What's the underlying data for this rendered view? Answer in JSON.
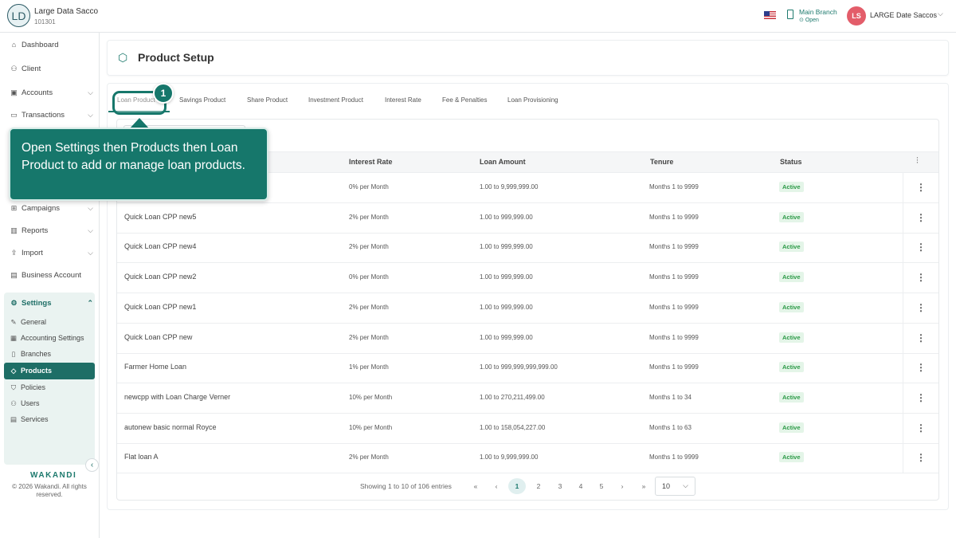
{
  "topbar": {
    "org_initials": "LD",
    "org_name": "Large Data Sacco",
    "org_code": "101301",
    "branch_label": "Main Branch",
    "branch_status": "Open",
    "user_initials": "LS",
    "user_name": "LARGE Date Saccos"
  },
  "sidebar": {
    "items": [
      {
        "label": "Dashboard",
        "icon": "home-icon"
      },
      {
        "label": "Client",
        "icon": "users-icon"
      },
      {
        "label": "Accounts",
        "icon": "wallet-icon"
      },
      {
        "label": "Transactions",
        "icon": "card-icon"
      },
      {
        "label": "Campaigns",
        "icon": "grid-icon"
      },
      {
        "label": "Reports",
        "icon": "chart-icon"
      },
      {
        "label": "Import",
        "icon": "upload-icon"
      },
      {
        "label": "Business Account",
        "icon": "briefcase-icon"
      }
    ],
    "settings_label": "Settings",
    "settings_sub": [
      {
        "label": "General",
        "icon": "wrench-icon"
      },
      {
        "label": "Accounting Settings",
        "icon": "calculator-icon"
      },
      {
        "label": "Branches",
        "icon": "building-icon"
      },
      {
        "label": "Products",
        "icon": "tag-icon"
      },
      {
        "label": "Policies",
        "icon": "shield-icon"
      },
      {
        "label": "Users",
        "icon": "users-icon"
      },
      {
        "label": "Services",
        "icon": "services-icon"
      }
    ],
    "brand": "WAKANDI",
    "copyright": "© 2026 Wakandi. All rights reserved."
  },
  "page": {
    "title": "Product Setup",
    "tabs": [
      "Loan Product",
      "Savings Product",
      "Share Product",
      "Investment Product",
      "Interest Rate",
      "Fee & Penalties",
      "Loan Provisioning"
    ]
  },
  "table": {
    "headers": {
      "rate": "Interest Rate",
      "amount": "Loan Amount",
      "tenure": "Tenure",
      "status": "Status"
    },
    "rows": [
      {
        "name": "",
        "rate": "0% per Month",
        "amount": "1.00 to 9,999,999.00",
        "tenure": "Months 1 to 9999",
        "status": "Active"
      },
      {
        "name": "Quick Loan CPP new5",
        "rate": "2% per Month",
        "amount": "1.00 to 999,999.00",
        "tenure": "Months 1 to 9999",
        "status": "Active"
      },
      {
        "name": "Quick Loan CPP new4",
        "rate": "2% per Month",
        "amount": "1.00 to 999,999.00",
        "tenure": "Months 1 to 9999",
        "status": "Active"
      },
      {
        "name": "Quick Loan CPP new2",
        "rate": "0% per Month",
        "amount": "1.00 to 999,999.00",
        "tenure": "Months 1 to 9999",
        "status": "Active"
      },
      {
        "name": "Quick Loan CPP new1",
        "rate": "2% per Month",
        "amount": "1.00 to 999,999.00",
        "tenure": "Months 1 to 9999",
        "status": "Active"
      },
      {
        "name": "Quick Loan CPP new",
        "rate": "2% per Month",
        "amount": "1.00 to 999,999.00",
        "tenure": "Months 1 to 9999",
        "status": "Active"
      },
      {
        "name": "Farmer Home Loan",
        "rate": "1% per Month",
        "amount": "1.00 to 999,999,999,999.00",
        "tenure": "Months 1 to 9999",
        "status": "Active"
      },
      {
        "name": "newcpp with Loan Charge Verner",
        "rate": "10% per Month",
        "amount": "1.00 to 270,211,499.00",
        "tenure": "Months 1 to 34",
        "status": "Active"
      },
      {
        "name": "autonew basic normal Royce",
        "rate": "10% per Month",
        "amount": "1.00 to 158,054,227.00",
        "tenure": "Months 1 to 63",
        "status": "Active"
      },
      {
        "name": "Flat loan A",
        "rate": "2% per Month",
        "amount": "1.00 to 9,999,999.00",
        "tenure": "Months 1 to 9999",
        "status": "Active"
      }
    ]
  },
  "pagination": {
    "summary": "Showing 1 to 10 of 106 entries",
    "first": "«",
    "prev": "‹",
    "pages": [
      "1",
      "2",
      "3",
      "4",
      "5"
    ],
    "next": "›",
    "last": "»",
    "current_page": "1",
    "page_size": "10"
  },
  "tutorial": {
    "step": "1",
    "text": "Open Settings then Products then Loan Product to add or manage loan products."
  },
  "colors": {
    "accent": "#1e7a6e",
    "active_badge_bg": "#e4f5e8",
    "active_badge_text": "#2c9a47",
    "avatar": "#e35d6a"
  }
}
